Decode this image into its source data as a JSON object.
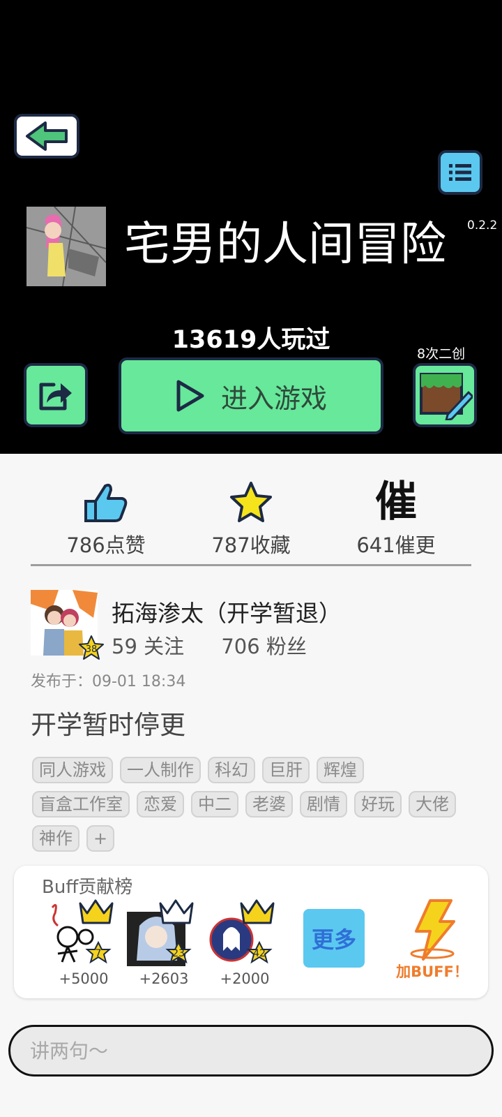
{
  "header": {
    "game_title": "宅男的人间冒险",
    "version": "0.2.2",
    "played_text": "13619人玩过",
    "play_label": "进入游戏",
    "derive_count": "8次二创"
  },
  "stats": [
    {
      "label": "786点赞",
      "icon": "thumbs-up-icon"
    },
    {
      "label": "787收藏",
      "icon": "star-icon"
    },
    {
      "label": "641催更",
      "icon": "urge-icon",
      "glyph": "催"
    }
  ],
  "author": {
    "name": "拓海渗太（开学暂退）",
    "level": "38",
    "following": "59 关注",
    "followers": "706 粉丝",
    "published": "发布于：09-01 18:34"
  },
  "notice": "开学暂时停更",
  "tags": [
    [
      "同人游戏",
      "一人制作",
      "科幻",
      "巨肝",
      "辉煌"
    ],
    [
      "盲盒工作室",
      "恋爱",
      "中二",
      "老婆",
      "剧情",
      "好玩",
      "大佬"
    ],
    [
      "神作",
      "+"
    ]
  ],
  "buff": {
    "title": "Buff贡献榜",
    "users": [
      {
        "level": "7",
        "score": "+5000"
      },
      {
        "level": "23",
        "score": "+2603"
      },
      {
        "level": "42",
        "score": "+2000"
      }
    ],
    "more_label": "更多",
    "add_label": "加BUFF！"
  },
  "comment": {
    "placeholder": "讲两句～"
  },
  "colors": {
    "accent_green": "#67e89b",
    "accent_blue": "#5bc8f0",
    "border_navy": "#1d2a44",
    "gold": "#f5d31c"
  }
}
